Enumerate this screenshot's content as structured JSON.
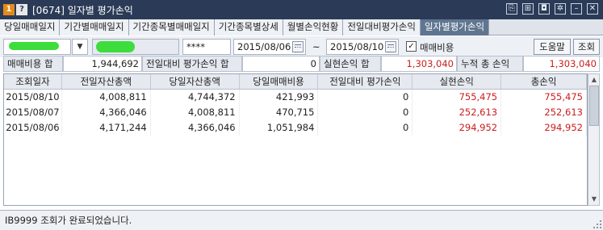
{
  "window": {
    "badge1": "1",
    "badge2": "?",
    "title": "[0674] 일자별 평가손익",
    "icons": [
      "link-icon",
      "pin-icon",
      "camera-icon",
      "gear-icon",
      "minimize-icon",
      "close-icon"
    ]
  },
  "tabs": [
    {
      "label": "당일매매일지",
      "active": false
    },
    {
      "label": "기간별매매일지",
      "active": false
    },
    {
      "label": "기간종목별매매일지",
      "active": false
    },
    {
      "label": "기간종목별상세",
      "active": false
    },
    {
      "label": "월별손익현황",
      "active": false
    },
    {
      "label": "전일대비평가손익",
      "active": false
    },
    {
      "label": "일자별평가손익",
      "active": true
    }
  ],
  "filter": {
    "password_mask": "****",
    "start_date": "2015/08/06",
    "range_sep": "~",
    "end_date": "2015/08/10",
    "fee_checked": true,
    "fee_check_mark": "✓",
    "fee_label": "매매비용",
    "help_button": "도움말",
    "query_button": "조회"
  },
  "summary": {
    "fee_total_label": "매매비용 합",
    "fee_total_value": "1,944,692",
    "prev_diff_label": "전일대비 평가손익 합",
    "prev_diff_value": "0",
    "realized_label": "실현손익 합",
    "realized_value": "1,303,040",
    "cumulative_label": "누적 총 손익",
    "cumulative_value": "1,303,040"
  },
  "grid": {
    "columns": [
      "조회일자",
      "전일자산총액",
      "당일자산총액",
      "당일매매비용",
      "전일대비 평가손익",
      "실현손익",
      "총손익"
    ],
    "rows": [
      [
        "2015/08/10",
        "4,008,811",
        "4,744,372",
        "421,993",
        "0",
        "755,475",
        "755,475"
      ],
      [
        "2015/08/07",
        "4,366,046",
        "4,008,811",
        "470,715",
        "0",
        "252,613",
        "252,613"
      ],
      [
        "2015/08/06",
        "4,171,244",
        "4,366,046",
        "1,051,984",
        "0",
        "294,952",
        "294,952"
      ]
    ]
  },
  "status": {
    "message": "IB9999 조회가 완료되었습니다."
  },
  "colors": {
    "title_bar": "#2b3b57",
    "active_tab": "#607690",
    "profit_red": "#cc1d1d",
    "redaction_green": "#3cdd3c"
  }
}
